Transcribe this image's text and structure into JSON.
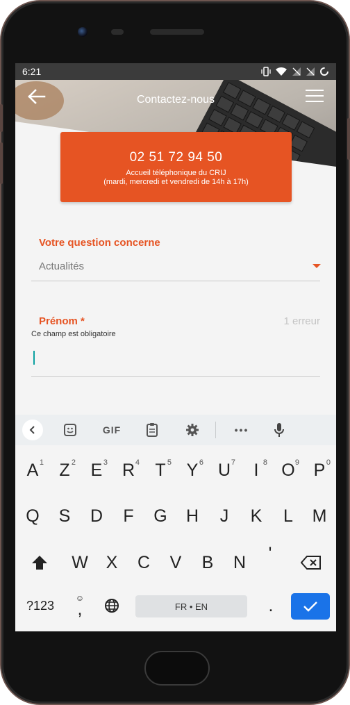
{
  "status_bar": {
    "time": "6:21"
  },
  "header": {
    "title": "Contactez-nous"
  },
  "contact_card": {
    "phone": "02 51 72 94 50",
    "line1": "Accueil téléphonique du CRIJ",
    "line2": "(mardi, mercredi et vendredi de 14h à 17h)"
  },
  "form": {
    "question_label": "Votre question concerne",
    "question_value": "Actualités",
    "firstname_label": "Prénom *",
    "firstname_error_count": "1 erreur",
    "firstname_error_text": "Ce champ est obligatoire"
  },
  "keyboard": {
    "gif_label": "GIF",
    "more_label": "•••",
    "row1": [
      {
        "k": "A",
        "n": "1"
      },
      {
        "k": "Z",
        "n": "2"
      },
      {
        "k": "E",
        "n": "3"
      },
      {
        "k": "R",
        "n": "4"
      },
      {
        "k": "T",
        "n": "5"
      },
      {
        "k": "Y",
        "n": "6"
      },
      {
        "k": "U",
        "n": "7"
      },
      {
        "k": "I",
        "n": "8"
      },
      {
        "k": "O",
        "n": "9"
      },
      {
        "k": "P",
        "n": "0"
      }
    ],
    "row2": [
      "Q",
      "S",
      "D",
      "F",
      "G",
      "H",
      "J",
      "K",
      "L",
      "M"
    ],
    "row3": [
      "W",
      "X",
      "C",
      "V",
      "B",
      "N",
      "'"
    ],
    "symbols_label": "?123",
    "emoji_comma": ",",
    "space_label": "FR • EN",
    "period": "."
  }
}
